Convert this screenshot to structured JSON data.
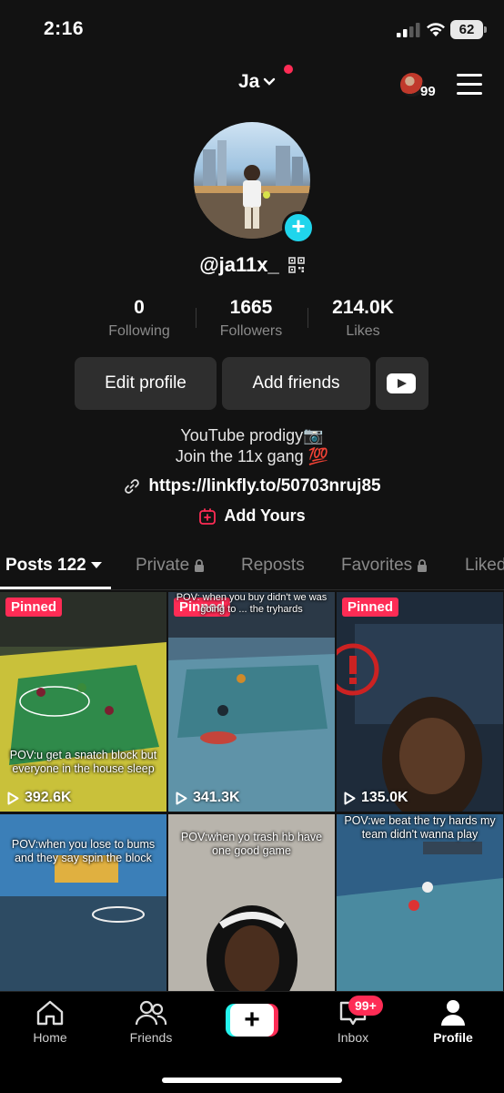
{
  "status_bar": {
    "time": "2:16",
    "battery": "62"
  },
  "header": {
    "account_name": "Ja",
    "badge_count": "99"
  },
  "profile": {
    "username": "@ja11x_",
    "stats": [
      {
        "value": "0",
        "label": "Following"
      },
      {
        "value": "1665",
        "label": "Followers"
      },
      {
        "value": "214.0K",
        "label": "Likes"
      }
    ],
    "buttons": {
      "edit": "Edit profile",
      "add_friends": "Add friends"
    },
    "bio_line1": "YouTube prodigy📷",
    "bio_line2": "Join the 11x gang  💯",
    "link": "https://linkfly.to/50703nruj85",
    "add_yours": "Add Yours"
  },
  "tabs": [
    "Posts 122",
    "Private",
    "Reposts",
    "Favorites",
    "Liked"
  ],
  "posts": [
    {
      "pinned": "Pinned",
      "caption": "POV:u get a snatch block but everyone in the house sleep",
      "views": "392.6K"
    },
    {
      "pinned": "Pinned",
      "caption": "POV: when you buy didn't we was going to ... the tryhards",
      "views": "341.3K"
    },
    {
      "pinned": "Pinned",
      "caption": "",
      "views": "135.0K"
    },
    {
      "caption": "POV:when you lose to bums and they say spin the block"
    },
    {
      "caption": "POV:when yo trash hb have one good game"
    },
    {
      "caption": "POV:we beat the try hards my team didn't wanna play"
    }
  ],
  "bottom_nav": {
    "home": "Home",
    "friends": "Friends",
    "inbox": "Inbox",
    "inbox_badge": "99+",
    "profile": "Profile"
  },
  "colors": {
    "accent": "#fe2c55",
    "cyan": "#25f4ee",
    "background": "#121212"
  }
}
